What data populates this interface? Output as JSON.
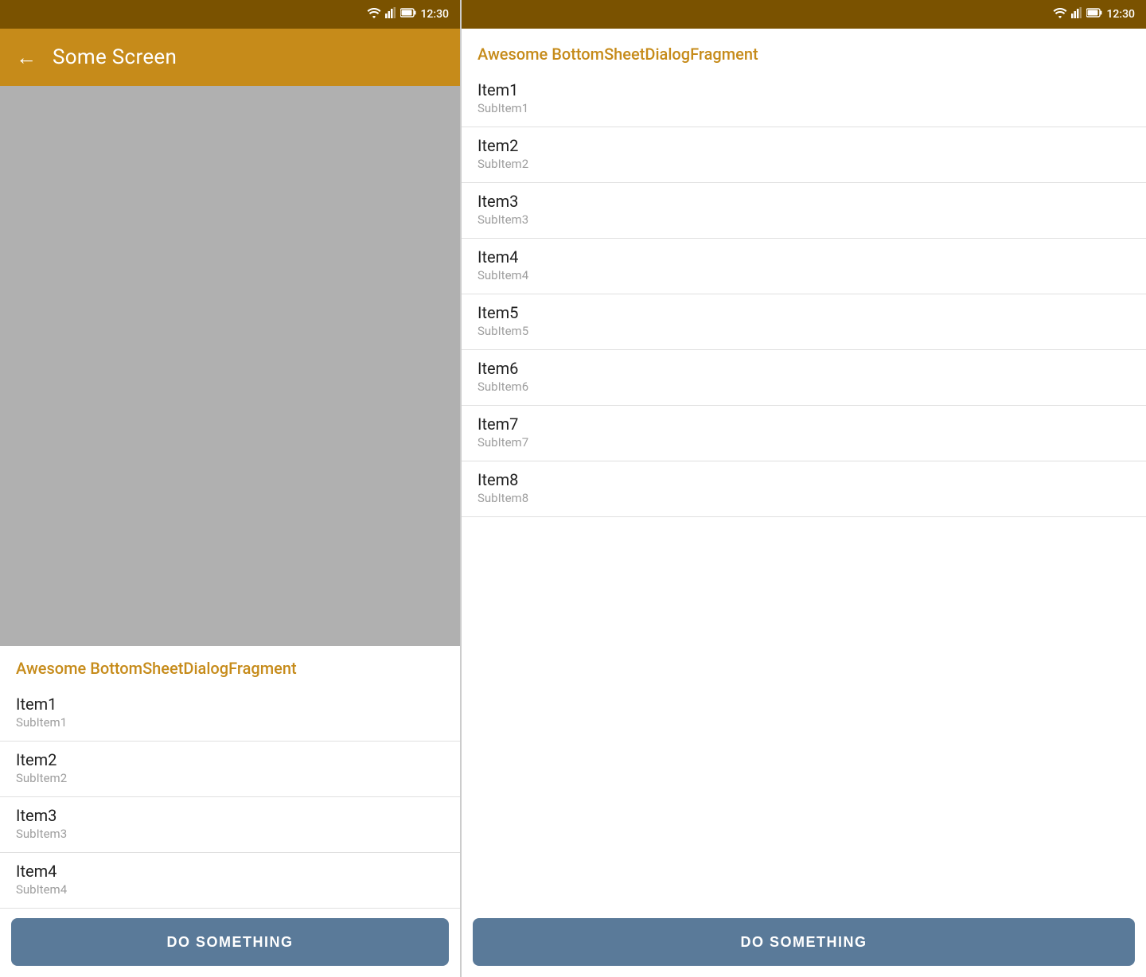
{
  "colors": {
    "toolbar": "#c68b1a",
    "statusBar": "#7a5200",
    "accent": "#c68b1a",
    "button": "#5a7a99",
    "divider": "#e0e0e0",
    "itemTitle": "#212121",
    "itemSubtitle": "#9e9e9e",
    "white": "#ffffff"
  },
  "left": {
    "statusBar": {
      "time": "12:30"
    },
    "toolbar": {
      "backLabel": "←",
      "title": "Some Screen"
    },
    "sheet": {
      "title": "Awesome BottomSheetDialogFragment",
      "items": [
        {
          "title": "Item1",
          "subtitle": "SubItem1"
        },
        {
          "title": "Item2",
          "subtitle": "SubItem2"
        },
        {
          "title": "Item3",
          "subtitle": "SubItem3"
        },
        {
          "title": "Item4",
          "subtitle": "SubItem4"
        }
      ],
      "buttonLabel": "DO SOMETHING"
    }
  },
  "right": {
    "statusBar": {
      "time": "12:30"
    },
    "sheet": {
      "title": "Awesome BottomSheetDialogFragment",
      "items": [
        {
          "title": "Item1",
          "subtitle": "SubItem1"
        },
        {
          "title": "Item2",
          "subtitle": "SubItem2"
        },
        {
          "title": "Item3",
          "subtitle": "SubItem3"
        },
        {
          "title": "Item4",
          "subtitle": "SubItem4"
        },
        {
          "title": "Item5",
          "subtitle": "SubItem5"
        },
        {
          "title": "Item6",
          "subtitle": "SubItem6"
        },
        {
          "title": "Item7",
          "subtitle": "SubItem7"
        },
        {
          "title": "Item8",
          "subtitle": "SubItem8"
        }
      ],
      "buttonLabel": "DO SOMETHING"
    }
  }
}
